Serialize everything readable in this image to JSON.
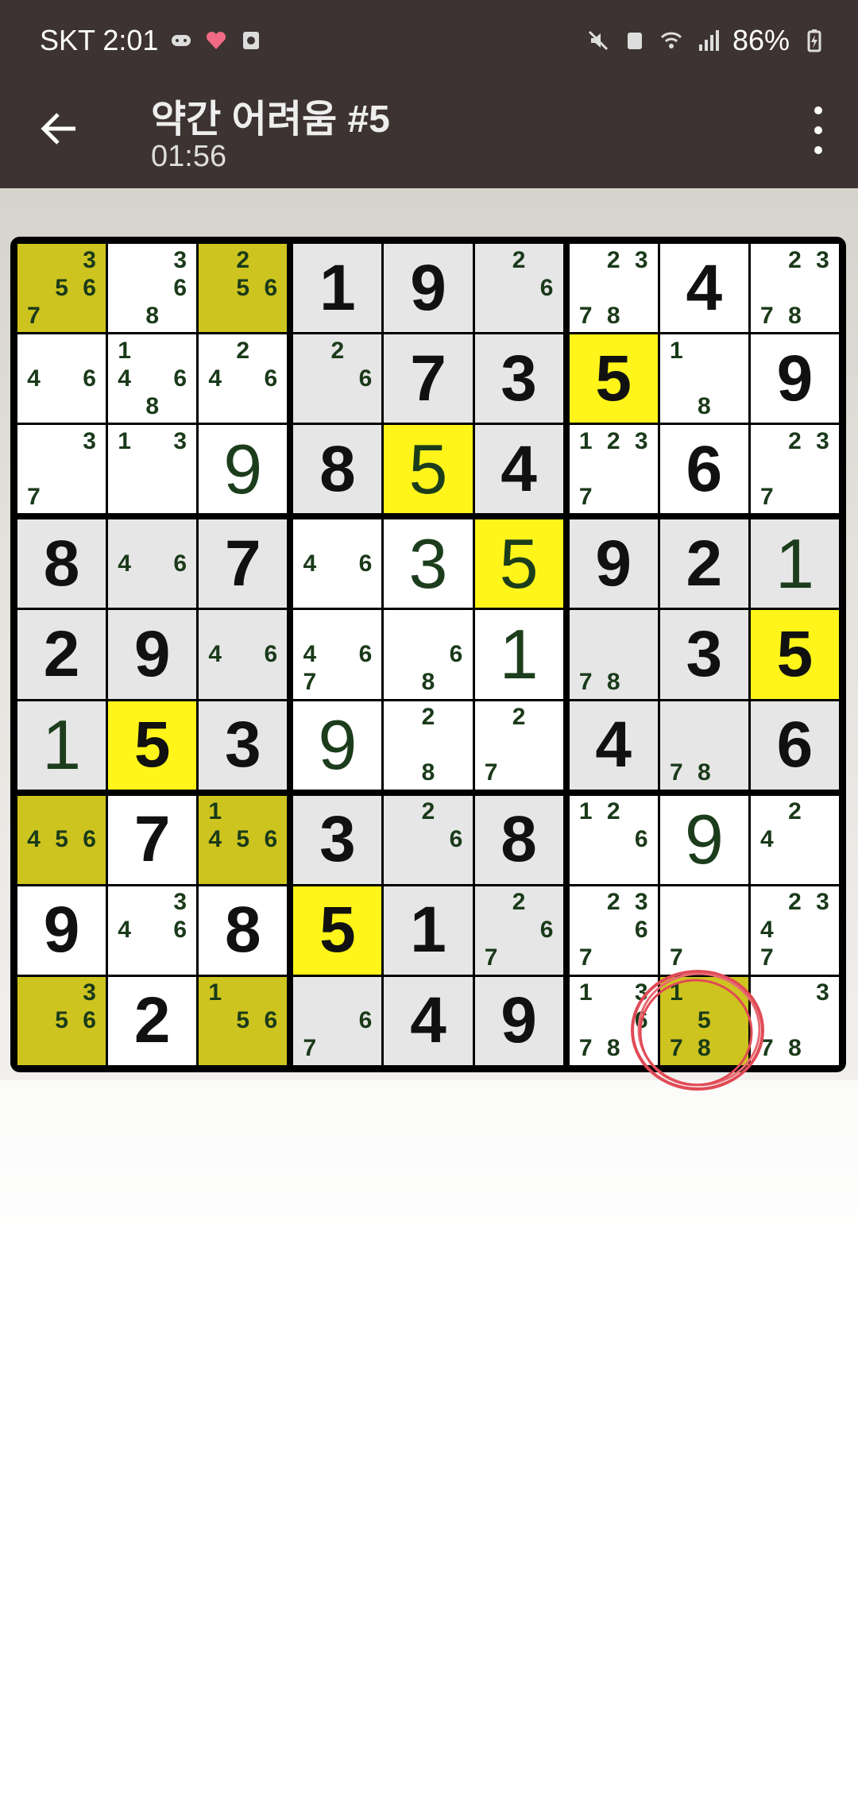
{
  "status_bar": {
    "carrier_time": "SKT 2:01",
    "battery": "86%",
    "left_icons": [
      "game-icon",
      "heart-icon",
      "screenshot-icon"
    ],
    "right_icons": [
      "mute-icon",
      "recycle-icon",
      "wifi-icon",
      "signal-icon",
      "battery-icon"
    ]
  },
  "header": {
    "title": "약간 어려움 #5",
    "timer": "01:56"
  },
  "colors": {
    "bar": "#3d3332",
    "white_cell": "#ffffff",
    "grey_cell": "#e6e6e6",
    "yellow_highlight": "#fff51a",
    "olive_highlight": "#cdc41f"
  },
  "board": {
    "rows": [
      [
        {
          "n": [
            3,
            5,
            6,
            7
          ],
          "bg": "olive"
        },
        {
          "n": [
            3,
            6,
            8
          ],
          "bg": "white"
        },
        {
          "n": [
            2,
            5,
            6
          ],
          "bg": "olive"
        },
        {
          "v": "1",
          "g": 1,
          "bg": "grey"
        },
        {
          "v": "9",
          "g": 1,
          "bg": "grey"
        },
        {
          "n": [
            2,
            6
          ],
          "bg": "grey"
        },
        {
          "n": [
            2,
            3,
            7,
            8
          ],
          "bg": "white"
        },
        {
          "v": "4",
          "g": 1,
          "bg": "white"
        },
        {
          "n": [
            2,
            3,
            7,
            8
          ],
          "bg": "white"
        }
      ],
      [
        {
          "n": [
            4,
            6
          ],
          "bg": "white"
        },
        {
          "n": [
            1,
            4,
            6,
            8
          ],
          "bg": "white"
        },
        {
          "n": [
            2,
            4,
            6
          ],
          "bg": "white"
        },
        {
          "n": [
            2,
            6
          ],
          "bg": "grey"
        },
        {
          "v": "7",
          "g": 1,
          "bg": "grey"
        },
        {
          "v": "3",
          "g": 1,
          "bg": "grey"
        },
        {
          "v": "5",
          "g": 1,
          "bg": "yellow"
        },
        {
          "n": [
            1,
            8
          ],
          "bg": "white"
        },
        {
          "v": "9",
          "g": 1,
          "bg": "white"
        }
      ],
      [
        {
          "n": [
            3,
            7
          ],
          "bg": "white"
        },
        {
          "n": [
            1,
            3
          ],
          "bg": "white"
        },
        {
          "v": "9",
          "g": 0,
          "bg": "white"
        },
        {
          "v": "8",
          "g": 1,
          "bg": "grey"
        },
        {
          "v": "5",
          "g": 0,
          "bg": "yellow"
        },
        {
          "v": "4",
          "g": 1,
          "bg": "grey"
        },
        {
          "n": [
            1,
            2,
            3,
            7
          ],
          "bg": "white"
        },
        {
          "v": "6",
          "g": 1,
          "bg": "white"
        },
        {
          "n": [
            2,
            3,
            7
          ],
          "bg": "white"
        }
      ],
      [
        {
          "v": "8",
          "g": 1,
          "bg": "grey"
        },
        {
          "n": [
            4,
            6
          ],
          "bg": "grey"
        },
        {
          "v": "7",
          "g": 1,
          "bg": "grey"
        },
        {
          "n": [
            4,
            6
          ],
          "bg": "white"
        },
        {
          "v": "3",
          "g": 0,
          "bg": "white"
        },
        {
          "v": "5",
          "g": 0,
          "bg": "yellow"
        },
        {
          "v": "9",
          "g": 1,
          "bg": "grey"
        },
        {
          "v": "2",
          "g": 1,
          "bg": "grey"
        },
        {
          "v": "1",
          "g": 0,
          "bg": "grey"
        }
      ],
      [
        {
          "v": "2",
          "g": 1,
          "bg": "grey"
        },
        {
          "v": "9",
          "g": 1,
          "bg": "grey"
        },
        {
          "n": [
            4,
            6
          ],
          "bg": "grey"
        },
        {
          "n": [
            4,
            6,
            7
          ],
          "bg": "white"
        },
        {
          "n": [
            6,
            8
          ],
          "bg": "white"
        },
        {
          "v": "1",
          "g": 0,
          "bg": "white"
        },
        {
          "n": [
            7,
            8
          ],
          "bg": "grey"
        },
        {
          "v": "3",
          "g": 1,
          "bg": "grey"
        },
        {
          "v": "5",
          "g": 1,
          "bg": "yellow"
        }
      ],
      [
        {
          "v": "1",
          "g": 0,
          "bg": "grey"
        },
        {
          "v": "5",
          "g": 1,
          "bg": "yellow"
        },
        {
          "v": "3",
          "g": 1,
          "bg": "grey"
        },
        {
          "v": "9",
          "g": 0,
          "bg": "white"
        },
        {
          "n": [
            2,
            8
          ],
          "bg": "white"
        },
        {
          "n": [
            2,
            7
          ],
          "bg": "white"
        },
        {
          "v": "4",
          "g": 1,
          "bg": "grey"
        },
        {
          "n": [
            7,
            8
          ],
          "bg": "grey"
        },
        {
          "v": "6",
          "g": 1,
          "bg": "grey"
        }
      ],
      [
        {
          "n": [
            4,
            5,
            6
          ],
          "bg": "olive"
        },
        {
          "v": "7",
          "g": 1,
          "bg": "white"
        },
        {
          "n": [
            1,
            4,
            5,
            6
          ],
          "bg": "olive"
        },
        {
          "v": "3",
          "g": 1,
          "bg": "grey"
        },
        {
          "n": [
            2,
            6
          ],
          "bg": "grey"
        },
        {
          "v": "8",
          "g": 1,
          "bg": "grey"
        },
        {
          "n": [
            1,
            2,
            6
          ],
          "bg": "white"
        },
        {
          "v": "9",
          "g": 0,
          "bg": "white"
        },
        {
          "n": [
            2,
            4
          ],
          "bg": "white"
        }
      ],
      [
        {
          "v": "9",
          "g": 1,
          "bg": "white"
        },
        {
          "n": [
            3,
            4,
            6
          ],
          "bg": "white"
        },
        {
          "v": "8",
          "g": 1,
          "bg": "white"
        },
        {
          "v": "5",
          "g": 1,
          "bg": "yellow"
        },
        {
          "v": "1",
          "g": 1,
          "bg": "grey"
        },
        {
          "n": [
            2,
            6,
            7
          ],
          "bg": "grey"
        },
        {
          "n": [
            2,
            3,
            6,
            7
          ],
          "bg": "white"
        },
        {
          "n": [
            7
          ],
          "bg": "white"
        },
        {
          "n": [
            2,
            3,
            4,
            7
          ],
          "bg": "white"
        }
      ],
      [
        {
          "n": [
            3,
            5,
            6
          ],
          "bg": "olive"
        },
        {
          "v": "2",
          "g": 1,
          "bg": "white"
        },
        {
          "n": [
            1,
            5,
            6
          ],
          "bg": "olive"
        },
        {
          "n": [
            6,
            7
          ],
          "bg": "grey"
        },
        {
          "v": "4",
          "g": 1,
          "bg": "grey"
        },
        {
          "v": "9",
          "g": 1,
          "bg": "grey"
        },
        {
          "n": [
            1,
            3,
            6,
            7,
            8
          ],
          "bg": "white"
        },
        {
          "n": [
            1,
            5,
            7,
            8
          ],
          "bg": "olive"
        },
        {
          "n": [
            3,
            7,
            8
          ],
          "bg": "white"
        }
      ]
    ]
  }
}
